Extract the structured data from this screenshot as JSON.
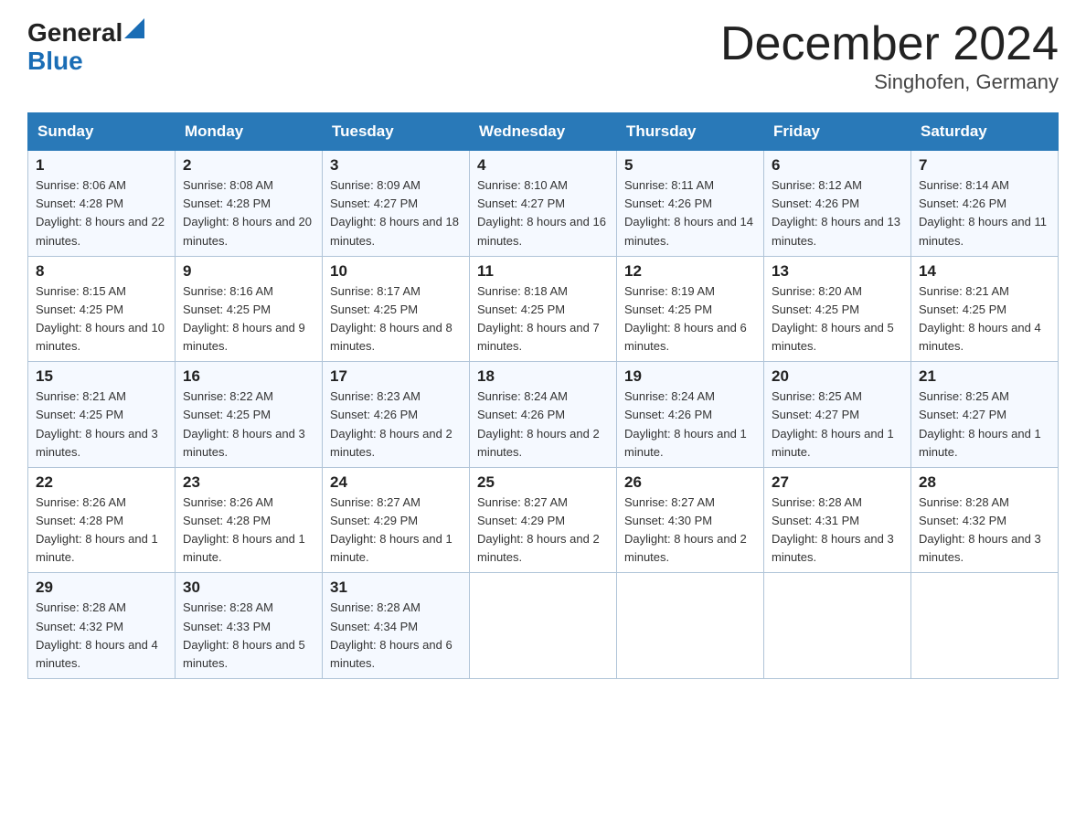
{
  "header": {
    "logo_general": "General",
    "logo_blue": "Blue",
    "month_title": "December 2024",
    "location": "Singhofen, Germany"
  },
  "days_of_week": [
    "Sunday",
    "Monday",
    "Tuesday",
    "Wednesday",
    "Thursday",
    "Friday",
    "Saturday"
  ],
  "weeks": [
    [
      {
        "day": "1",
        "sunrise": "8:06 AM",
        "sunset": "4:28 PM",
        "daylight": "8 hours and 22 minutes."
      },
      {
        "day": "2",
        "sunrise": "8:08 AM",
        "sunset": "4:28 PM",
        "daylight": "8 hours and 20 minutes."
      },
      {
        "day": "3",
        "sunrise": "8:09 AM",
        "sunset": "4:27 PM",
        "daylight": "8 hours and 18 minutes."
      },
      {
        "day": "4",
        "sunrise": "8:10 AM",
        "sunset": "4:27 PM",
        "daylight": "8 hours and 16 minutes."
      },
      {
        "day": "5",
        "sunrise": "8:11 AM",
        "sunset": "4:26 PM",
        "daylight": "8 hours and 14 minutes."
      },
      {
        "day": "6",
        "sunrise": "8:12 AM",
        "sunset": "4:26 PM",
        "daylight": "8 hours and 13 minutes."
      },
      {
        "day": "7",
        "sunrise": "8:14 AM",
        "sunset": "4:26 PM",
        "daylight": "8 hours and 11 minutes."
      }
    ],
    [
      {
        "day": "8",
        "sunrise": "8:15 AM",
        "sunset": "4:25 PM",
        "daylight": "8 hours and 10 minutes."
      },
      {
        "day": "9",
        "sunrise": "8:16 AM",
        "sunset": "4:25 PM",
        "daylight": "8 hours and 9 minutes."
      },
      {
        "day": "10",
        "sunrise": "8:17 AM",
        "sunset": "4:25 PM",
        "daylight": "8 hours and 8 minutes."
      },
      {
        "day": "11",
        "sunrise": "8:18 AM",
        "sunset": "4:25 PM",
        "daylight": "8 hours and 7 minutes."
      },
      {
        "day": "12",
        "sunrise": "8:19 AM",
        "sunset": "4:25 PM",
        "daylight": "8 hours and 6 minutes."
      },
      {
        "day": "13",
        "sunrise": "8:20 AM",
        "sunset": "4:25 PM",
        "daylight": "8 hours and 5 minutes."
      },
      {
        "day": "14",
        "sunrise": "8:21 AM",
        "sunset": "4:25 PM",
        "daylight": "8 hours and 4 minutes."
      }
    ],
    [
      {
        "day": "15",
        "sunrise": "8:21 AM",
        "sunset": "4:25 PM",
        "daylight": "8 hours and 3 minutes."
      },
      {
        "day": "16",
        "sunrise": "8:22 AM",
        "sunset": "4:25 PM",
        "daylight": "8 hours and 3 minutes."
      },
      {
        "day": "17",
        "sunrise": "8:23 AM",
        "sunset": "4:26 PM",
        "daylight": "8 hours and 2 minutes."
      },
      {
        "day": "18",
        "sunrise": "8:24 AM",
        "sunset": "4:26 PM",
        "daylight": "8 hours and 2 minutes."
      },
      {
        "day": "19",
        "sunrise": "8:24 AM",
        "sunset": "4:26 PM",
        "daylight": "8 hours and 1 minute."
      },
      {
        "day": "20",
        "sunrise": "8:25 AM",
        "sunset": "4:27 PM",
        "daylight": "8 hours and 1 minute."
      },
      {
        "day": "21",
        "sunrise": "8:25 AM",
        "sunset": "4:27 PM",
        "daylight": "8 hours and 1 minute."
      }
    ],
    [
      {
        "day": "22",
        "sunrise": "8:26 AM",
        "sunset": "4:28 PM",
        "daylight": "8 hours and 1 minute."
      },
      {
        "day": "23",
        "sunrise": "8:26 AM",
        "sunset": "4:28 PM",
        "daylight": "8 hours and 1 minute."
      },
      {
        "day": "24",
        "sunrise": "8:27 AM",
        "sunset": "4:29 PM",
        "daylight": "8 hours and 1 minute."
      },
      {
        "day": "25",
        "sunrise": "8:27 AM",
        "sunset": "4:29 PM",
        "daylight": "8 hours and 2 minutes."
      },
      {
        "day": "26",
        "sunrise": "8:27 AM",
        "sunset": "4:30 PM",
        "daylight": "8 hours and 2 minutes."
      },
      {
        "day": "27",
        "sunrise": "8:28 AM",
        "sunset": "4:31 PM",
        "daylight": "8 hours and 3 minutes."
      },
      {
        "day": "28",
        "sunrise": "8:28 AM",
        "sunset": "4:32 PM",
        "daylight": "8 hours and 3 minutes."
      }
    ],
    [
      {
        "day": "29",
        "sunrise": "8:28 AM",
        "sunset": "4:32 PM",
        "daylight": "8 hours and 4 minutes."
      },
      {
        "day": "30",
        "sunrise": "8:28 AM",
        "sunset": "4:33 PM",
        "daylight": "8 hours and 5 minutes."
      },
      {
        "day": "31",
        "sunrise": "8:28 AM",
        "sunset": "4:34 PM",
        "daylight": "8 hours and 6 minutes."
      },
      null,
      null,
      null,
      null
    ]
  ],
  "labels": {
    "sunrise": "Sunrise:",
    "sunset": "Sunset:",
    "daylight": "Daylight:"
  }
}
